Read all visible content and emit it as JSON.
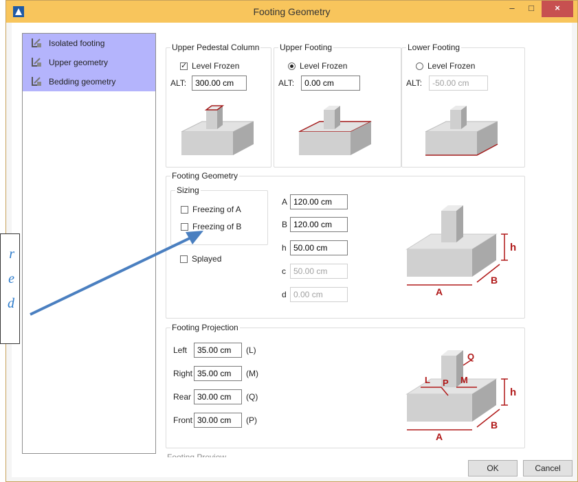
{
  "window": {
    "title": "Footing Geometry",
    "minimize_icon": "minimize-icon",
    "maximize_icon": "maximize-icon",
    "close_icon": "close-icon",
    "close_glyph": "×"
  },
  "tree": {
    "items": [
      {
        "label": "Isolated footing",
        "icon": "footing-tree-icon"
      },
      {
        "label": "Upper geometry",
        "icon": "footing-tree-icon"
      },
      {
        "label": "Bedding geometry",
        "icon": "footing-tree-icon"
      }
    ]
  },
  "upper_pedestal": {
    "title": "Upper Pedestal Column",
    "frozen_label": "Level Frozen",
    "frozen_checked": true,
    "alt_label": "ALT:",
    "alt_value": "300.00 cm"
  },
  "upper_footing": {
    "title": "Upper Footing",
    "frozen_label": "Level Frozen",
    "frozen_selected": true,
    "alt_label": "ALT:",
    "alt_value": "0.00 cm"
  },
  "lower_footing": {
    "title": "Lower Footing",
    "frozen_label": "Level Frozen",
    "frozen_selected": false,
    "alt_label": "ALT:",
    "alt_value": "-50.00 cm"
  },
  "footing_geometry": {
    "title": "Footing Geometry",
    "sizing_title": "Sizing",
    "freeze_a_label": "Freezing of A",
    "freeze_b_label": "Freezing of B",
    "splayed_label": "Splayed",
    "fields": [
      {
        "label": "A",
        "value": "120.00 cm",
        "enabled": true
      },
      {
        "label": "B",
        "value": "120.00 cm",
        "enabled": true
      },
      {
        "label": "h",
        "value": "50.00 cm",
        "enabled": true
      },
      {
        "label": "c",
        "value": "50.00 cm",
        "enabled": false
      },
      {
        "label": "d",
        "value": "0.00 cm",
        "enabled": false
      }
    ],
    "diagram_labels": {
      "h": "h",
      "a": "A",
      "b": "B"
    }
  },
  "footing_projection": {
    "title": "Footing Projection",
    "rows": [
      {
        "label": "Left",
        "value": "35.00 cm",
        "code": "(L)"
      },
      {
        "label": "Right",
        "value": "35.00 cm",
        "code": "(M)"
      },
      {
        "label": "Rear",
        "value": "30.00 cm",
        "code": "(Q)"
      },
      {
        "label": "Front",
        "value": "30.00 cm",
        "code": "(P)"
      }
    ],
    "diagram_labels": {
      "l": "L",
      "p": "P",
      "m": "M",
      "q": "Q",
      "h": "h",
      "a": "A",
      "b": "B"
    }
  },
  "footing_preview": {
    "title": "Footing Preview"
  },
  "buttons": {
    "ok": "OK",
    "cancel": "Cancel"
  },
  "callout": {
    "lines": [
      "r",
      "e",
      "d"
    ]
  },
  "colors": {
    "titlebar": "#f8c55c",
    "close": "#c75050",
    "tree_selected": "#b4b4fc",
    "dim_red": "#b01818",
    "arrow": "#4a7fc0"
  }
}
